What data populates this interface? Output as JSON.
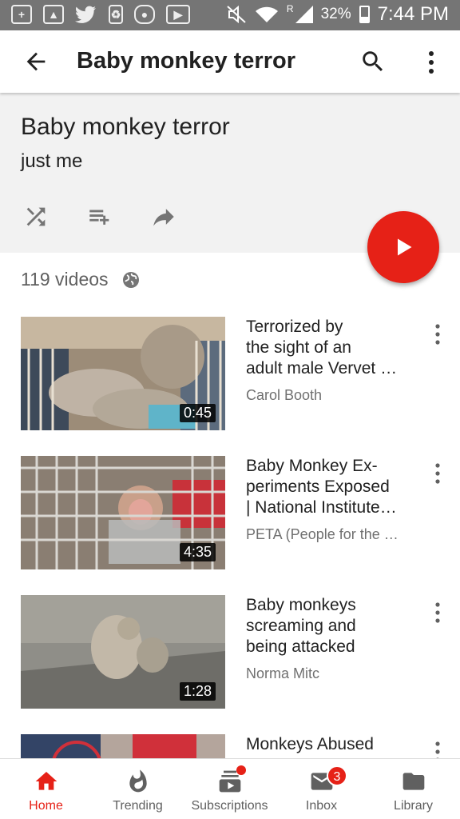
{
  "status_bar": {
    "battery": "32%",
    "time": "7:44 PM",
    "network_indicator": "R"
  },
  "app_bar": {
    "title": "Baby monkey terror",
    "back_icon": "arrow-back-icon",
    "search_icon": "search-icon",
    "menu_icon": "more-vert-icon"
  },
  "playlist": {
    "title": "Baby monkey terror",
    "owner": "just me",
    "video_count": "119 videos",
    "privacy_icon": "globe-icon",
    "actions": [
      "shuffle-icon",
      "add-to-queue-icon",
      "share-icon"
    ],
    "play_icon": "play-icon"
  },
  "videos": [
    {
      "title_lines": [
        "Terrorized by",
        "the sight of an",
        "adult male Vervet …"
      ],
      "channel": "Carol Booth",
      "duration": "0:45"
    },
    {
      "title_lines": [
        "Baby Monkey Ex-",
        "periments Exposed",
        "| National Institute…"
      ],
      "channel": "PETA (People for the …",
      "duration": "4:35"
    },
    {
      "title_lines": [
        "Baby monkeys",
        "screaming and",
        "being attacked"
      ],
      "channel": "Norma Mitc",
      "duration": "1:28"
    },
    {
      "title_lines": [
        "Monkeys Abused"
      ],
      "channel": "",
      "duration": ""
    }
  ],
  "bottom_nav": {
    "tabs": [
      {
        "label": "Home",
        "icon": "home-icon",
        "active": true
      },
      {
        "label": "Trending",
        "icon": "flame-icon"
      },
      {
        "label": "Subscriptions",
        "icon": "subscriptions-icon"
      },
      {
        "label": "Inbox",
        "icon": "inbox-icon",
        "badge": "3"
      },
      {
        "label": "Library",
        "icon": "folder-icon"
      }
    ]
  },
  "colors": {
    "accent": "#e62117",
    "status_bar": "#757575",
    "header_bg": "#f2f2f2"
  }
}
